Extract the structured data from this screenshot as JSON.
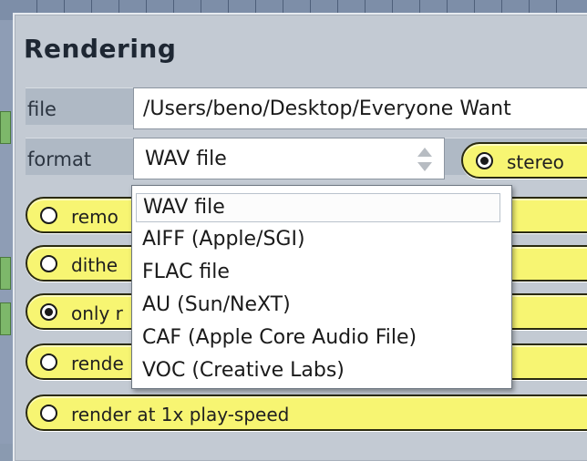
{
  "panel": {
    "title": "Rendering"
  },
  "file": {
    "label": "file",
    "value": "/Users/beno/Desktop/Everyone Want"
  },
  "format": {
    "label": "format",
    "selected": "WAV file",
    "options": [
      "WAV file",
      "AIFF (Apple/SGI)",
      "FLAC file",
      "AU (Sun/NeXT)",
      "CAF (Apple Core Audio File)",
      "VOC (Creative Labs)"
    ]
  },
  "channels": {
    "label": "stereo",
    "checked": true
  },
  "options": [
    {
      "label": "remo",
      "checked": false
    },
    {
      "label": "dithe",
      "checked": false
    },
    {
      "label": "only r",
      "checked": true
    },
    {
      "label": "rende",
      "checked": false
    },
    {
      "label": "render at 1x play-speed",
      "checked": false
    }
  ],
  "colors": {
    "pill_fill": "#f7f572",
    "panel_bg": "#c3cad3"
  }
}
